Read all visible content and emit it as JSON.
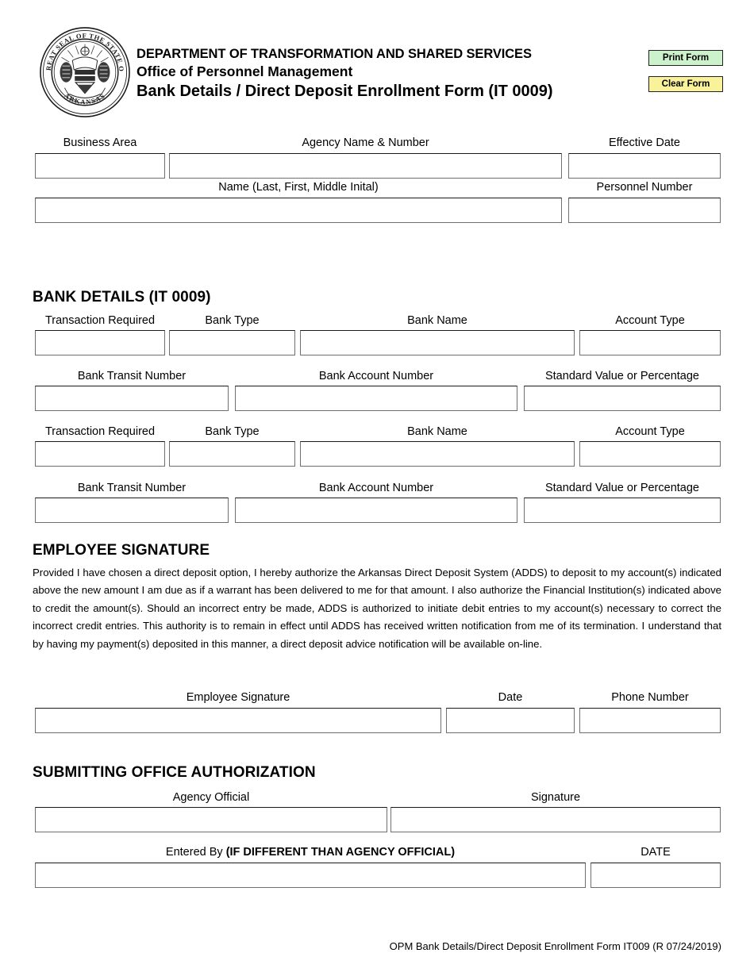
{
  "header": {
    "seal_text": "GREAT SEAL OF THE STATE OF ARKANSAS",
    "department": "DEPARTMENT OF TRANSFORMATION AND SHARED SERVICES",
    "office": "Office of Personnel Management",
    "form_title": "Bank Details / Direct Deposit Enrollment Form (IT 0009)",
    "print_button": "Print Form",
    "clear_button": "Clear Form",
    "print_button_color": "#ccf2cc",
    "clear_button_color": "#f9f29a"
  },
  "top_section": {
    "business_area": {
      "label": "Business Area",
      "value": "",
      "placeholder": ""
    },
    "agency_name_number": {
      "label": "Agency Name & Number",
      "value": "",
      "placeholder": ""
    },
    "effective_date": {
      "label": "Effective Date",
      "value": "",
      "placeholder": ""
    },
    "name": {
      "label": "Name (Last, First, Middle Inital)",
      "value": "",
      "placeholder": ""
    },
    "personnel_number": {
      "label": "Personnel Number",
      "value": "",
      "placeholder": ""
    }
  },
  "bank_details": {
    "heading": "BANK DETAILS (IT 0009)",
    "blocks": [
      {
        "transaction_required": {
          "label": "Transaction Required",
          "value": ""
        },
        "bank_type": {
          "label": "Bank Type",
          "value": ""
        },
        "bank_name": {
          "label": "Bank Name",
          "value": ""
        },
        "account_type": {
          "label": "Account Type",
          "value": ""
        },
        "bank_transit_number": {
          "label": "Bank Transit Number",
          "value": ""
        },
        "bank_account_number": {
          "label": "Bank Account Number",
          "value": ""
        },
        "standard_value_or_percentage": {
          "label": "Standard Value or Percentage",
          "value": ""
        }
      },
      {
        "transaction_required": {
          "label": "Transaction Required",
          "value": ""
        },
        "bank_type": {
          "label": "Bank Type",
          "value": ""
        },
        "bank_name": {
          "label": "Bank Name",
          "value": ""
        },
        "account_type": {
          "label": "Account Type",
          "value": ""
        },
        "bank_transit_number": {
          "label": "Bank Transit Number",
          "value": ""
        },
        "bank_account_number": {
          "label": "Bank Account Number",
          "value": ""
        },
        "standard_value_or_percentage": {
          "label": "Standard Value or Percentage",
          "value": ""
        }
      }
    ]
  },
  "employee_signature": {
    "heading": "EMPLOYEE SIGNATURE",
    "consent_text": "Provided I have chosen a direct deposit option, I hereby authorize the Arkansas Direct Deposit System (ADDS) to deposit to my account(s) indicated above the new amount I am due as if a warrant has been delivered to me for that amount.  I also authorize the Financial Institution(s) indicated above to credit the amount(s).  Should an incorrect entry be made, ADDS is authorized to initiate debit entries to my account(s) necessary to correct the incorrect credit entries.  This authority is to remain in effect until ADDS has received written notification from me of its termination.  I understand that by having my payment(s) deposited in this manner, a direct deposit advice notification will be available on-line.",
    "signature": {
      "label": "Employee Signature",
      "value": ""
    },
    "date": {
      "label": "Date",
      "value": ""
    },
    "phone_number": {
      "label": "Phone Number",
      "value": ""
    }
  },
  "submitting_office": {
    "heading": "SUBMITTING OFFICE AUTHORIZATION",
    "agency_official": {
      "label": "Agency Official",
      "value": ""
    },
    "signature": {
      "label": "Signature",
      "value": ""
    },
    "entered_by_label_normal": "Entered By ",
    "entered_by_label_bold": "(IF DIFFERENT THAN AGENCY OFFICIAL)",
    "entered_by": {
      "value": ""
    },
    "date": {
      "label": "DATE",
      "value": ""
    }
  },
  "footer": {
    "text": "OPM Bank Details/Direct Deposit Enrollment Form IT009 (R 07/24/2019)"
  }
}
